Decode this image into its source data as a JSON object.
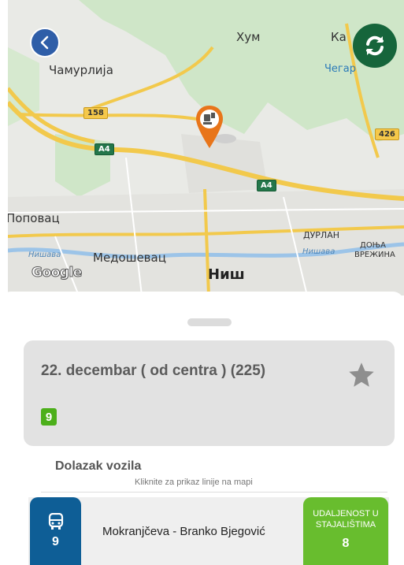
{
  "map": {
    "places": {
      "hum": "Хум",
      "kamenica": "Ка",
      "chegar": "Чегар",
      "chamurlija": "Чамурлија",
      "popovac": "Поповац",
      "medoshevac": "Медошевац",
      "nish": "Ниш",
      "durlan": "ДУРЛАН",
      "donja_vrezhina_1": "ДОЊА",
      "donja_vrezhina_2": "ВРЕЖИНА",
      "nishava_left": "Нишава",
      "nishava_right": "Нишава"
    },
    "shields": {
      "r158": "158",
      "a4_left": "A4",
      "a4_center": "A4",
      "r426": "426"
    },
    "attribution": "Google",
    "accent_back": "#2f5ea8",
    "accent_refresh": "#16653b",
    "marker_color": "#e8751a"
  },
  "route": {
    "title": "22. decembar ( od centra ) (225)",
    "line_badge": "9"
  },
  "arrivals": {
    "title": "Dolazak vozila",
    "hint": "Kliknite za prikaz linije na mapi",
    "items": [
      {
        "line": "9",
        "stop": "Mokranjčeva - Branko Bjegović",
        "distance_label": "UDALJENOST U STAJALIŠTIMA",
        "distance_value": "8"
      }
    ]
  },
  "colors": {
    "bus_blue": "#0e5e96",
    "distance_green": "#68bd2e",
    "badge_green": "#4caf1a"
  }
}
